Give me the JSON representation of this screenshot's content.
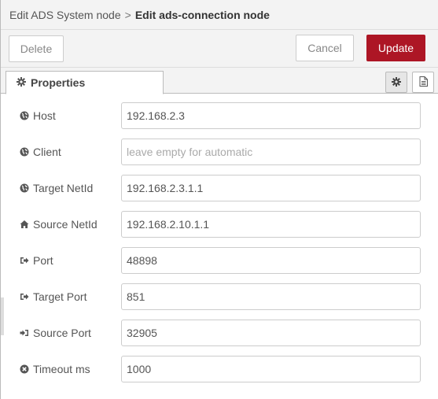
{
  "breadcrumb": {
    "parent": "Edit ADS System node",
    "separator": ">",
    "current": "Edit ads-connection node"
  },
  "toolbar": {
    "delete_label": "Delete",
    "cancel_label": "Cancel",
    "update_label": "Update",
    "accent_color": "#ad1625"
  },
  "tabs": {
    "properties_label": "Properties",
    "settings_icon": "cog-icon",
    "docs_icon": "file-text-icon"
  },
  "fields": [
    {
      "label": "Host",
      "icon": "globe-icon",
      "value": "192.168.2.3",
      "placeholder": ""
    },
    {
      "label": "Client",
      "icon": "globe-icon",
      "value": "",
      "placeholder": "leave empty for automatic"
    },
    {
      "label": "Target NetId",
      "icon": "globe-icon",
      "value": "192.168.2.3.1.1",
      "placeholder": ""
    },
    {
      "label": "Source NetId",
      "icon": "home-icon",
      "value": "192.168.2.10.1.1",
      "placeholder": ""
    },
    {
      "label": "Port",
      "icon": "sign-out-icon",
      "value": "48898",
      "placeholder": ""
    },
    {
      "label": "Target Port",
      "icon": "sign-out-icon",
      "value": "851",
      "placeholder": ""
    },
    {
      "label": "Source Port",
      "icon": "sign-in-icon",
      "value": "32905",
      "placeholder": ""
    },
    {
      "label": "Timeout ms",
      "icon": "times-circle-icon",
      "value": "1000",
      "placeholder": ""
    }
  ]
}
